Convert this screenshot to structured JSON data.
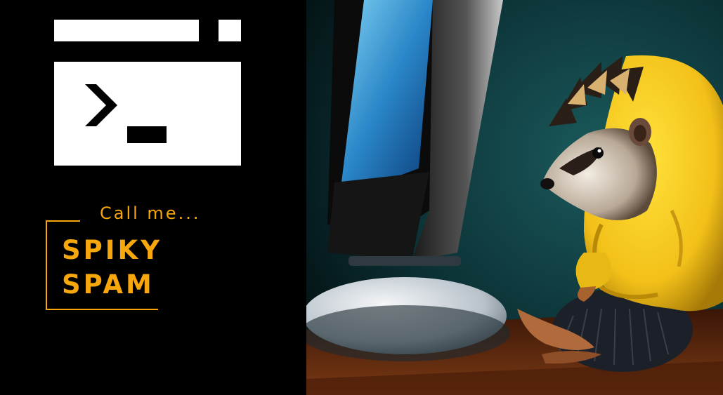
{
  "banner": {
    "tagline": "Call me...",
    "title_line1": "SPIKY",
    "title_line2": "SPAM"
  },
  "colors": {
    "accent": "#F7A70B",
    "background": "#000000",
    "logo": "#FFFFFF",
    "hoodie": "#F2C81A",
    "backdrop": "#0E3A3E"
  },
  "icons": {
    "logo": "terminal-window-icon"
  }
}
